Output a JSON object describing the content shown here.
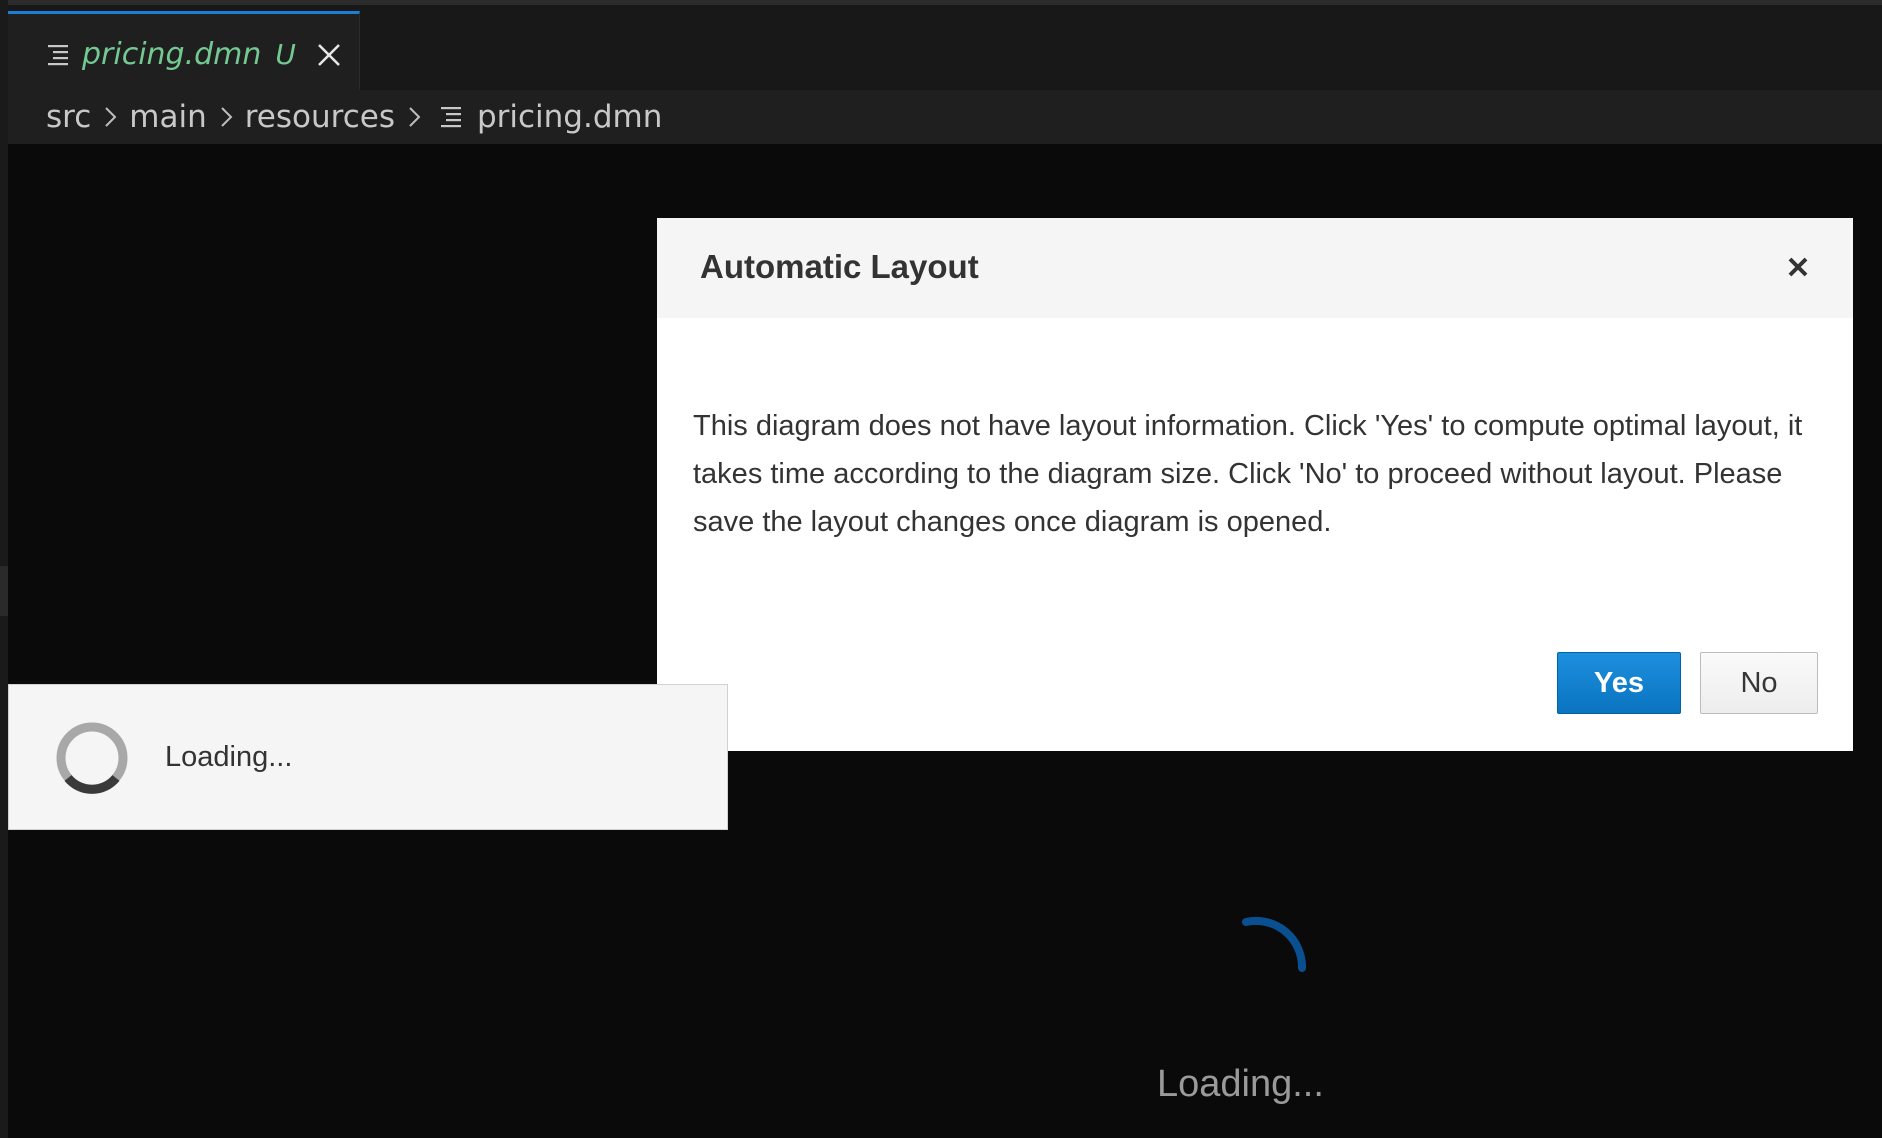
{
  "tab": {
    "file_name": "pricing.dmn",
    "status_flag": "U",
    "file_icon": "file-lines-icon",
    "close_icon": "close-icon"
  },
  "breadcrumb": {
    "items": [
      "src",
      "main",
      "resources"
    ],
    "file": "pricing.dmn"
  },
  "dialog": {
    "title": "Automatic Layout",
    "message": "This diagram does not have layout information. Click 'Yes' to compute optimal layout, it takes time according to the diagram size. Click 'No' to proceed without layout. Please save the layout changes once diagram is opened.",
    "yes_label": "Yes",
    "no_label": "No"
  },
  "loading_popup": {
    "text": "Loading..."
  },
  "background_loader": {
    "text": "Loading..."
  },
  "colors": {
    "tab_accent": "#1a7fd4",
    "modified_file": "#73c991",
    "primary_button": "#0a74c0",
    "spinner_blue": "#0a4f8f"
  }
}
